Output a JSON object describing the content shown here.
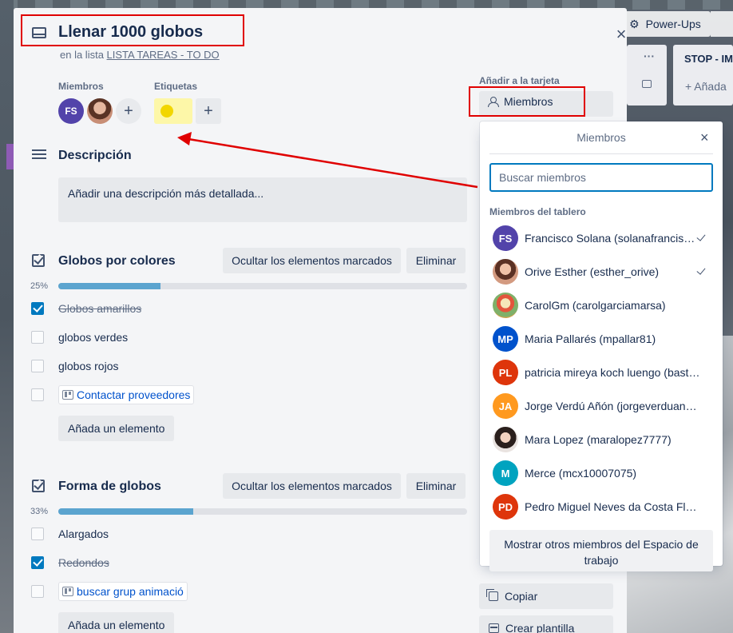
{
  "background": {
    "powerups_label": "Power-Ups",
    "list_title": "STOP - IM",
    "list_add": "+ Añada",
    "list_menu": "···"
  },
  "card": {
    "title": "Llenar 1000 globos",
    "in_list_prefix": "en la lista",
    "list_name": "LISTA TAREAS - TO DO",
    "close": "×"
  },
  "members_section": {
    "label": "Miembros",
    "avatars": [
      {
        "initials": "FS",
        "color": "#5243aa"
      },
      {
        "initials": "",
        "color": "#c88e76"
      }
    ],
    "add": "+"
  },
  "labels_section": {
    "label": "Etiquetas",
    "chip_color": "#f2d600",
    "add": "+"
  },
  "description": {
    "title": "Descripción",
    "placeholder": "Añadir una descripción más detallada..."
  },
  "checklists": [
    {
      "title": "Globos por colores",
      "hide_label": "Ocultar los elementos marcados",
      "delete_label": "Eliminar",
      "percent": "25%",
      "progress": 0.25,
      "items": [
        {
          "text": "Globos amarillos",
          "done": true,
          "link": false
        },
        {
          "text": "globos verdes",
          "done": false,
          "link": false
        },
        {
          "text": "globos rojos",
          "done": false,
          "link": false
        },
        {
          "text": "Contactar proveedores",
          "done": false,
          "link": true
        }
      ],
      "add_label": "Añada un elemento"
    },
    {
      "title": "Forma de globos",
      "hide_label": "Ocultar los elementos marcados",
      "delete_label": "Eliminar",
      "percent": "33%",
      "progress": 0.33,
      "items": [
        {
          "text": "Alargados",
          "done": false,
          "link": false
        },
        {
          "text": "Redondos",
          "done": true,
          "link": false
        },
        {
          "text": "buscar grup animació",
          "done": false,
          "link": true
        }
      ],
      "add_label": "Añada un elemento"
    }
  ],
  "sidebar": {
    "add_to_card": "Añadir a la tarjeta",
    "members_button": "Miembros",
    "copy": "Copiar",
    "create_template": "Crear plantilla"
  },
  "popover": {
    "title": "Miembros",
    "close": "×",
    "search_placeholder": "Buscar miembros",
    "section_label": "Miembros del tablero",
    "members": [
      {
        "name": "Francisco Solana (solanafrancisco...",
        "initials": "FS",
        "color": "#5243aa",
        "selected": true,
        "photo": ""
      },
      {
        "name": "Orive Esther (esther_orive)",
        "initials": "",
        "color": "#c88e76",
        "selected": true,
        "photo": "ph-orive"
      },
      {
        "name": "CarolGm (carolgarciamarsa)",
        "initials": "",
        "color": "#7fb069",
        "selected": false,
        "photo": "ph-carol"
      },
      {
        "name": "Maria Pallarés (mpallar81)",
        "initials": "MP",
        "color": "#0052cc",
        "selected": false,
        "photo": ""
      },
      {
        "name": "patricia mireya koch luengo (basted...",
        "initials": "PL",
        "color": "#de350b",
        "selected": false,
        "photo": ""
      },
      {
        "name": "Jorge Verdú Añón (jorgeverduanon)",
        "initials": "JA",
        "color": "#ff991f",
        "selected": false,
        "photo": ""
      },
      {
        "name": "Mara Lopez (maralopez7777)",
        "initials": "",
        "color": "#2a1f1c",
        "selected": false,
        "photo": "ph-mara"
      },
      {
        "name": "Merce (mcx10007075)",
        "initials": "M",
        "color": "#00a3bf",
        "selected": false,
        "photo": ""
      },
      {
        "name": "Pedro Miguel Neves da Costa Flore...",
        "initials": "PD",
        "color": "#de350b",
        "selected": false,
        "photo": ""
      }
    ],
    "show_others": "Mostrar otros miembros del Espacio de trabajo"
  }
}
